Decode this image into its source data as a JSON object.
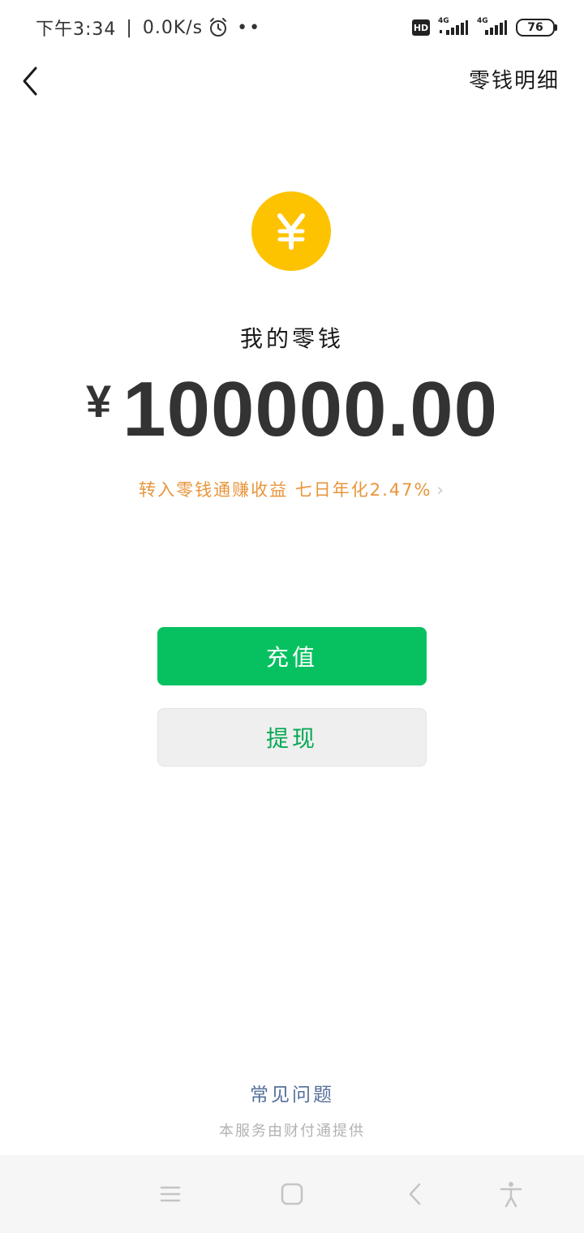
{
  "status_bar": {
    "time": "下午3:34",
    "network_speed": "0.0K/s",
    "extra": "••",
    "hd_label": "HD",
    "sim1_tag": "4G",
    "sim2_tag": "4G",
    "battery": "76"
  },
  "header": {
    "back_icon": "chevron-left-icon",
    "details_label": "零钱明细"
  },
  "main": {
    "coin_icon": "yuan-coin-icon",
    "coin_color": "#fdc300",
    "balance_label": "我的零钱",
    "currency_symbol": "¥",
    "balance_amount": "100000.00",
    "promo_text": "转入零钱通赚收益 七日年化2.47%",
    "promo_color": "#e8953a"
  },
  "actions": {
    "recharge_label": "充值",
    "recharge_color": "#07c160",
    "withdraw_label": "提现"
  },
  "footer": {
    "faq_label": "常见问题",
    "provider_note": "本服务由财付通提供"
  },
  "nav_bar": {
    "icons": [
      "menu-icon",
      "home-icon",
      "back-icon",
      "accessibility-icon"
    ]
  }
}
